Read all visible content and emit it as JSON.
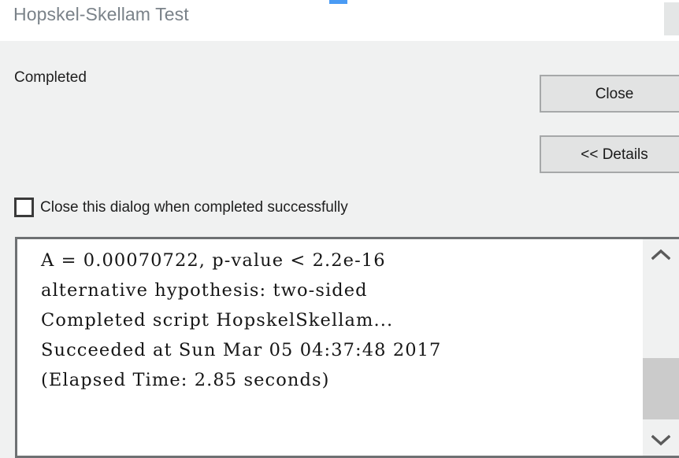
{
  "window": {
    "title": "Hopskel-Skellam Test",
    "accent_color": "#4a9bf4",
    "title_color": "#7a8289",
    "body_background": "#f0f1f1"
  },
  "status": {
    "label": "Completed"
  },
  "buttons": {
    "close": "Close",
    "details": "<< Details"
  },
  "options": {
    "close_on_success_label": "Close this dialog when completed successfully",
    "close_on_success_checked": false
  },
  "output": {
    "text": "A = 0.00070722, p-value < 2.2e-16\nalternative hypothesis: two-sided\nCompleted script HopskelSkellam...\nSucceeded at Sun Mar 05 04:37:48 2017\n(Elapsed Time: 2.85 seconds)",
    "lines": [
      "A = 0.00070722, p-value < 2.2e-16",
      "alternative hypothesis: two-sided",
      "Completed script HopskelSkellam...",
      "Succeeded at Sun Mar 05 04:37:48 2017",
      "(Elapsed Time: 2.85 seconds)"
    ]
  },
  "scrollbar": {
    "up_icon": "chevron-up-icon",
    "down_icon": "chevron-down-icon",
    "thumb_color": "#cbcbcb"
  }
}
